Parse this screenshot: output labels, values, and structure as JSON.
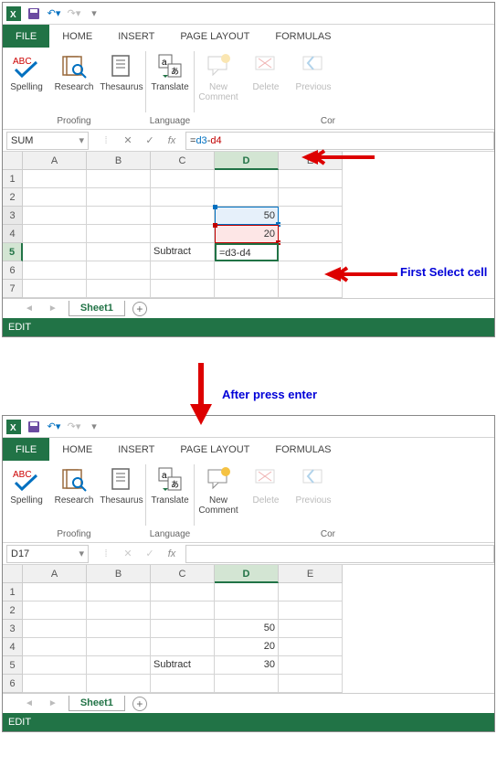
{
  "qat": {
    "app": "Excel"
  },
  "tabs": [
    "FILE",
    "HOME",
    "INSERT",
    "PAGE LAYOUT",
    "FORMULAS"
  ],
  "ribbon": {
    "proofing": {
      "label": "Proofing",
      "spelling": "Spelling",
      "research": "Research",
      "thesaurus": "Thesaurus"
    },
    "language": {
      "label": "Language",
      "translate": "Translate"
    },
    "comments": {
      "label": "Cor",
      "new": "New\nComment",
      "delete": "Delete",
      "previous": "Previous"
    }
  },
  "screenshot1": {
    "nameBox": "SUM",
    "formula_plain": "=",
    "formula_d3": "d3",
    "formula_dash": "-",
    "formula_d4": "d4",
    "cols": [
      "A",
      "B",
      "C",
      "D",
      "E"
    ],
    "rows": [
      "1",
      "2",
      "3",
      "4",
      "5",
      "6",
      "7"
    ],
    "c5": "Subtract",
    "d3": "50",
    "d4": "20",
    "d5": "=d3-d4",
    "sheet": "Sheet1",
    "status": "EDIT"
  },
  "screenshot2": {
    "nameBox": "D17",
    "cols": [
      "A",
      "B",
      "C",
      "D",
      "E"
    ],
    "rows": [
      "1",
      "2",
      "3",
      "4",
      "5",
      "6"
    ],
    "c5": "Subtract",
    "d3": "50",
    "d4": "20",
    "d5": "30",
    "sheet": "Sheet1",
    "status": "EDIT"
  },
  "annotations": {
    "firstSelect": "First Select cell",
    "afterEnter": "After press enter"
  }
}
